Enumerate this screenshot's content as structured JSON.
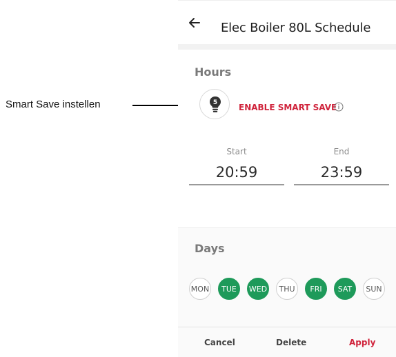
{
  "annotation": {
    "label": "Smart Save instellen"
  },
  "header": {
    "title": "Elec Boiler 80L Schedule"
  },
  "hours": {
    "title": "Hours",
    "bulb_badge": "5",
    "smart_save_label": "ENABLE SMART SAVE",
    "start_label": "Start",
    "start_value": "20:59",
    "end_label": "End",
    "end_value": "23:59"
  },
  "days": {
    "title": "Days",
    "items": [
      {
        "label": "MON",
        "selected": false
      },
      {
        "label": "TUE",
        "selected": true
      },
      {
        "label": "WED",
        "selected": true
      },
      {
        "label": "THU",
        "selected": false
      },
      {
        "label": "FRI",
        "selected": true
      },
      {
        "label": "SAT",
        "selected": true
      },
      {
        "label": "SUN",
        "selected": false
      }
    ]
  },
  "footer": {
    "cancel_label": "Cancel",
    "delete_label": "Delete",
    "apply_label": "Apply"
  },
  "colors": {
    "accent_green": "#1e9a5a",
    "accent_red": "#d0243c"
  },
  "icons": {
    "back": "arrow-left-icon",
    "bulb": "lightbulb-icon",
    "info": "info-icon"
  }
}
